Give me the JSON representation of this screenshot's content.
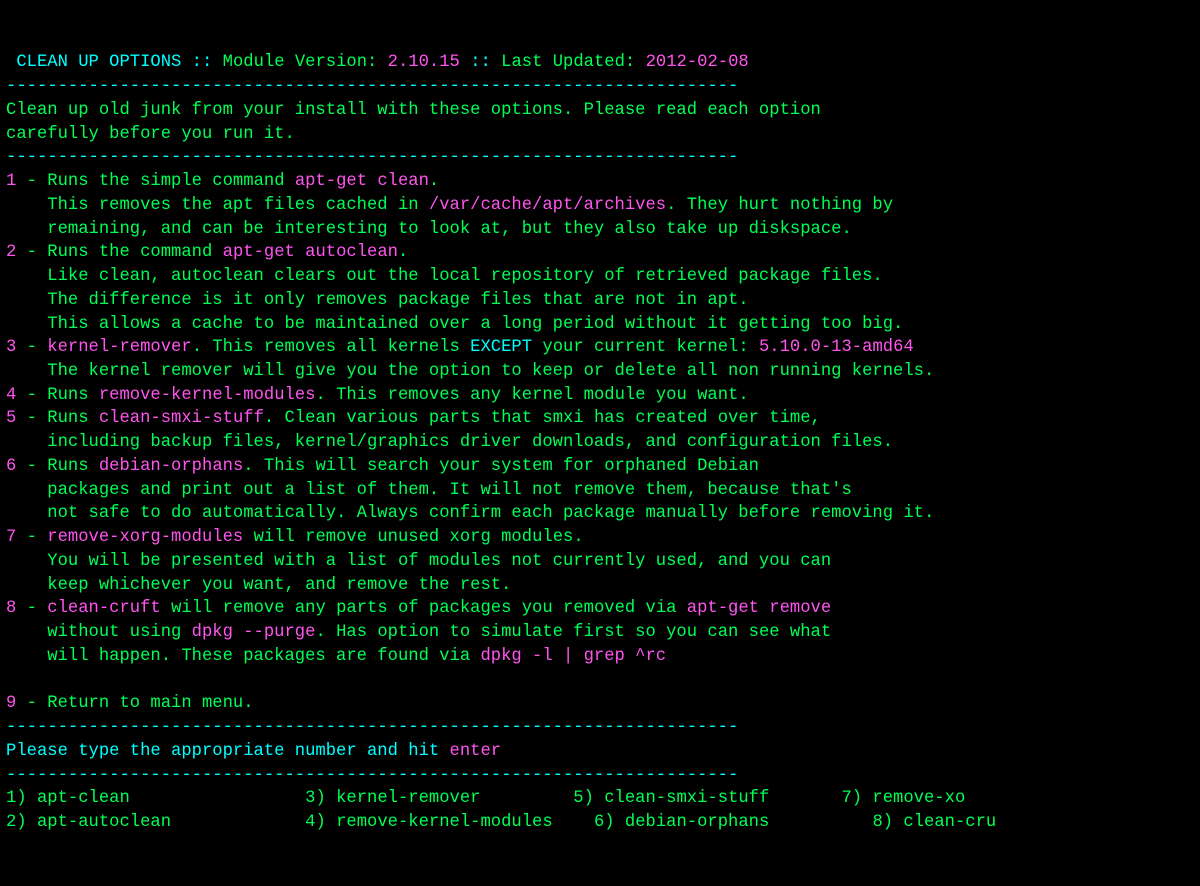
{
  "header": {
    "title": "CLEAN UP OPTIONS",
    "sep": " :: ",
    "mv_label": "Module Version:",
    "mv_value": "2.10.15",
    "lu_label": "Last Updated:",
    "lu_value": "2012-02-08"
  },
  "divider": "-----------------------------------------------------------------------",
  "intro1": "Clean up old junk from your install with these options. Please read each option",
  "intro2": "carefully before you run it.",
  "opt1": {
    "num": "1",
    "dash": " - ",
    "a": "Runs the simple command ",
    "cmd1": "apt-get clean",
    "b": ".",
    "c": "    This removes the apt files cached in ",
    "path": "/var/cache/apt/archives",
    "d": ". They hurt nothing by",
    "e": "    remaining, and can be interesting to look at, but they also take up diskspace."
  },
  "opt2": {
    "num": "2",
    "dash": " - ",
    "a": "Runs the command ",
    "cmd": "apt-get autoclean",
    "b": ".",
    "c": "    Like clean, autoclean clears out the local repository of retrieved package files.",
    "d": "    The difference is it only removes package files that are not in apt.",
    "e": "    This allows a cache to be maintained over a long period without it getting too big."
  },
  "opt3": {
    "num": "3",
    "dash": " - ",
    "cmd": "kernel-remover",
    "a": ". This removes all kernels ",
    "except": "EXCEPT",
    "b": " your current kernel: ",
    "kv": "5.10.0-13-amd64",
    "c": "    The kernel remover will give you the option to keep or delete all non running kernels."
  },
  "opt4": {
    "num": "4",
    "dash": " - ",
    "a": "Runs ",
    "cmd": "remove-kernel-modules",
    "b": ". This removes any kernel module you want."
  },
  "opt5": {
    "num": "5",
    "dash": " - ",
    "a": "Runs ",
    "cmd": "clean-smxi-stuff",
    "b": ". Clean various parts that smxi has created over time,",
    "c": "    including backup files, kernel/graphics driver downloads, and configuration files."
  },
  "opt6": {
    "num": "6",
    "dash": " - ",
    "a": "Runs ",
    "cmd": "debian-orphans",
    "b": ". This will search your system for orphaned Debian",
    "c": "    packages and print out a list of them. It will not remove them, because that's",
    "d": "    not safe to do automatically. Always confirm each package manually before removing it."
  },
  "opt7": {
    "num": "7",
    "dash": " - ",
    "cmd": "remove-xorg-modules",
    "a": " will remove unused xorg modules.",
    "b": "    You will be presented with a list of modules not currently used, and you can",
    "c": "    keep whichever you want, and remove the rest."
  },
  "opt8": {
    "num": "8",
    "dash": " - ",
    "cmd": "clean-cruft",
    "a": " will remove any parts of packages you removed via ",
    "cmd2": "apt-get remove",
    "b": "    without using ",
    "cmd3": "dpkg --purge",
    "c": ". Has option to simulate first so you can see what",
    "d": "    will happen. These packages are found via ",
    "cmd4": "dpkg -l | grep ^rc"
  },
  "opt9": {
    "num": "9",
    "dash": " - ",
    "a": "Return to main menu."
  },
  "prompt": {
    "a": "Please type the appropriate number and hit ",
    "b": "enter"
  },
  "menu": {
    "c1o1": "1) apt-clean",
    "c1o2": "2) apt-autoclean",
    "c2o1": "3) kernel-remover",
    "c2o2": "4) remove-kernel-modules",
    "c3o1": "5) clean-smxi-stuff",
    "c3o2": "6) debian-orphans",
    "c4o1": "7) remove-xo",
    "c4o2": "8) clean-cru"
  },
  "spaces": {
    "pad_a1": "                 ",
    "pad_a2": "         ",
    "pad_a3": "       ",
    "pad_b1": "             ",
    "pad_b2": "    ",
    "pad_b3": "          "
  }
}
